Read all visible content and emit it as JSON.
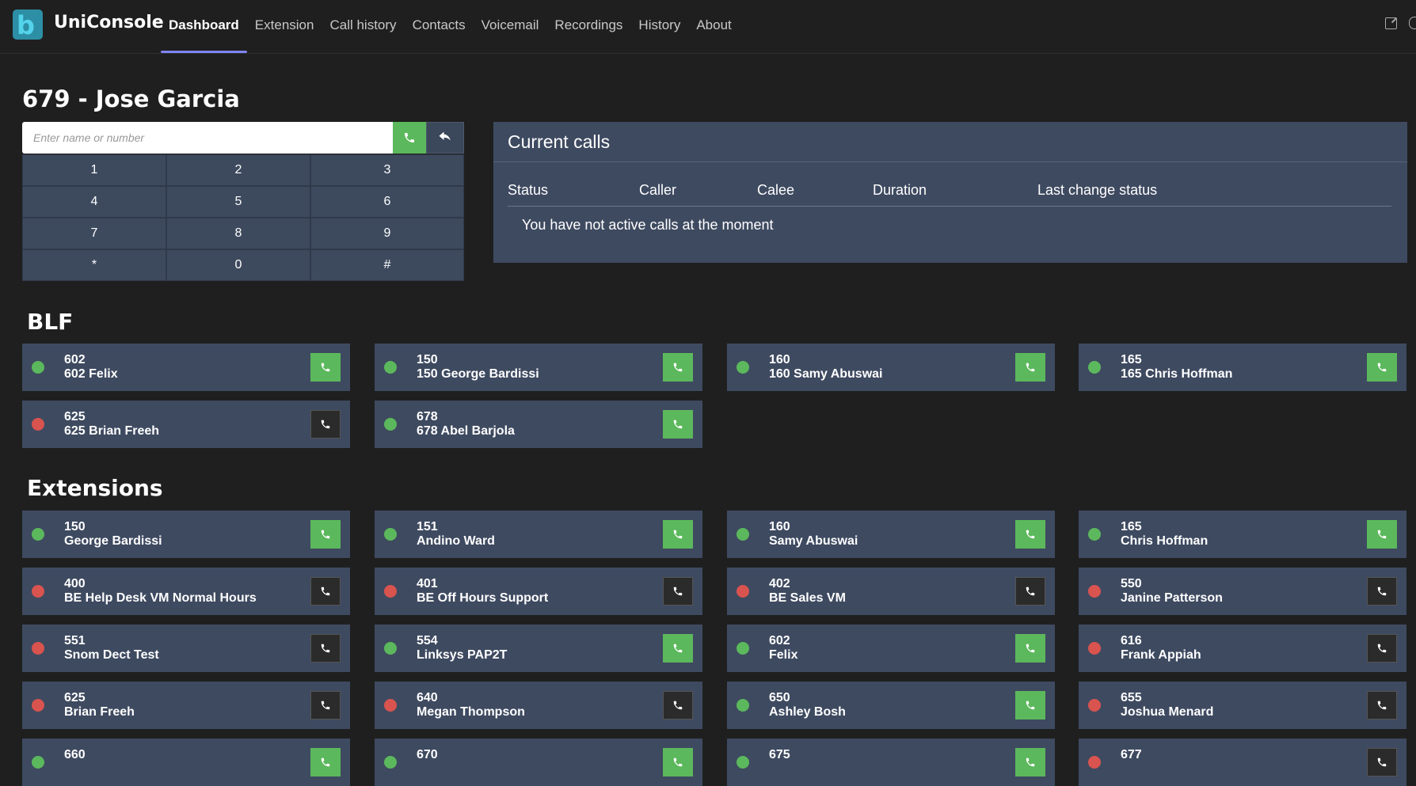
{
  "app": {
    "name": "UniConsole",
    "logo_letter": "b"
  },
  "nav": {
    "items": [
      "Dashboard",
      "Extension",
      "Call history",
      "Contacts",
      "Voicemail",
      "Recordings",
      "History",
      "About"
    ],
    "active": "Dashboard"
  },
  "extension_title": "679 - Jose Garcia",
  "dialer": {
    "placeholder": "Enter name or number",
    "keys": [
      "1",
      "2",
      "3",
      "4",
      "5",
      "6",
      "7",
      "8",
      "9",
      "*",
      "0",
      "#"
    ]
  },
  "current_calls": {
    "title": "Current calls",
    "columns": [
      "Status",
      "Caller",
      "Calee",
      "Duration",
      "Last change status"
    ],
    "empty_message": "You have not active calls at the moment"
  },
  "blf": {
    "title": "BLF",
    "items": [
      {
        "number": "602",
        "name": "602 Felix",
        "status": "available"
      },
      {
        "number": "150",
        "name": "150 George Bardissi",
        "status": "available"
      },
      {
        "number": "160",
        "name": "160 Samy Abuswai",
        "status": "available"
      },
      {
        "number": "165",
        "name": "165 Chris Hoffman",
        "status": "available"
      },
      {
        "number": "625",
        "name": "625 Brian Freeh",
        "status": "offline"
      },
      {
        "number": "678",
        "name": "678 Abel Barjola",
        "status": "available"
      }
    ]
  },
  "extensions": {
    "title": "Extensions",
    "items": [
      {
        "number": "150",
        "name": "George Bardissi",
        "status": "available"
      },
      {
        "number": "151",
        "name": "Andino Ward",
        "status": "available"
      },
      {
        "number": "160",
        "name": "Samy Abuswai",
        "status": "available"
      },
      {
        "number": "165",
        "name": "Chris Hoffman",
        "status": "available"
      },
      {
        "number": "400",
        "name": "BE Help Desk VM Normal Hours",
        "status": "offline"
      },
      {
        "number": "401",
        "name": "BE Off Hours Support",
        "status": "offline"
      },
      {
        "number": "402",
        "name": "BE Sales VM",
        "status": "offline"
      },
      {
        "number": "550",
        "name": "Janine Patterson",
        "status": "offline"
      },
      {
        "number": "551",
        "name": "Snom Dect Test",
        "status": "offline"
      },
      {
        "number": "554",
        "name": "Linksys PAP2T",
        "status": "available"
      },
      {
        "number": "602",
        "name": "Felix",
        "status": "available"
      },
      {
        "number": "616",
        "name": "Frank Appiah",
        "status": "offline"
      },
      {
        "number": "625",
        "name": "Brian Freeh",
        "status": "offline"
      },
      {
        "number": "640",
        "name": "Megan Thompson",
        "status": "offline"
      },
      {
        "number": "650",
        "name": "Ashley Bosh",
        "status": "available"
      },
      {
        "number": "655",
        "name": "Joshua Menard",
        "status": "offline"
      },
      {
        "number": "660",
        "name": "",
        "status": "available"
      },
      {
        "number": "670",
        "name": "",
        "status": "available"
      },
      {
        "number": "675",
        "name": "",
        "status": "available"
      },
      {
        "number": "677",
        "name": "",
        "status": "offline"
      }
    ]
  },
  "colors": {
    "available": "#5cb85c",
    "offline": "#d9534f",
    "card_bg": "#3e4a60",
    "accent": "#7f85f5"
  }
}
